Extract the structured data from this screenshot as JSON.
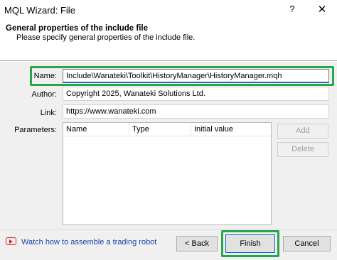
{
  "window": {
    "title": "MQL Wizard: File",
    "help_glyph": "?",
    "close_glyph": "✕"
  },
  "header": {
    "title": "General properties of the include file",
    "subtitle": "Please specify general properties of the include file."
  },
  "form": {
    "name_label": "Name:",
    "name_value": "Include\\Wanateki\\Toolkit\\HistoryManager\\HistoryManager.mqh",
    "author_label": "Author:",
    "author_value": "Copyright 2025, Wanateki Solutions Ltd.",
    "link_label": "Link:",
    "link_value": "https://www.wanateki.com",
    "parameters_label": "Parameters:"
  },
  "parameters_table": {
    "columns": [
      "Name",
      "Type",
      "Initial value"
    ],
    "rows": []
  },
  "side_buttons": {
    "add": "Add",
    "delete": "Delete"
  },
  "footer": {
    "video_icon": "youtube-play-icon",
    "link_text": "Watch how to assemble a trading robot",
    "back_label": "< Back",
    "finish_label": "Finish",
    "cancel_label": "Cancel"
  },
  "colors": {
    "highlight": "#27a64a",
    "link": "#1a44a8",
    "focus_border": "#2b67b6",
    "video_icon": "#e0241b"
  }
}
